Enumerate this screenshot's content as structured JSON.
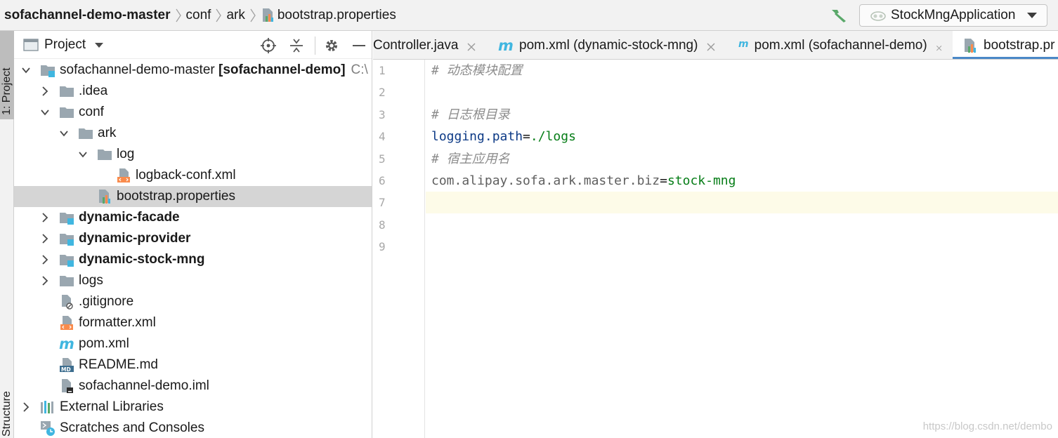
{
  "breadcrumb": {
    "items": [
      "sofachannel-demo-master",
      "conf",
      "ark",
      "bootstrap.properties"
    ]
  },
  "run_config": {
    "label": "StockMngApplication"
  },
  "tool_stripe": {
    "project_label": "1: Project",
    "structure_label": "Structure"
  },
  "project_panel": {
    "title": "Project",
    "tree": [
      {
        "label": "sofachannel-demo-master",
        "suffix": "[sofachannel-demo]",
        "path": "C:\\",
        "icon": "module-folder-icon",
        "depth": 0,
        "arrow": "down"
      },
      {
        "label": ".idea",
        "icon": "folder-icon",
        "depth": 1,
        "arrow": "right"
      },
      {
        "label": "conf",
        "icon": "folder-icon",
        "depth": 1,
        "arrow": "down"
      },
      {
        "label": "ark",
        "icon": "folder-icon",
        "depth": 2,
        "arrow": "down"
      },
      {
        "label": "log",
        "icon": "folder-icon",
        "depth": 3,
        "arrow": "down"
      },
      {
        "label": "logback-conf.xml",
        "icon": "xml-file-icon",
        "depth": 4,
        "arrow": ""
      },
      {
        "label": "bootstrap.properties",
        "icon": "properties-file-icon",
        "depth": 3,
        "arrow": "",
        "selected": true
      },
      {
        "label": "dynamic-facade",
        "icon": "module-folder-icon",
        "depth": 1,
        "arrow": "right",
        "bold": true
      },
      {
        "label": "dynamic-provider",
        "icon": "module-folder-icon",
        "depth": 1,
        "arrow": "right",
        "bold": true
      },
      {
        "label": "dynamic-stock-mng",
        "icon": "module-folder-icon",
        "depth": 1,
        "arrow": "right",
        "bold": true
      },
      {
        "label": "logs",
        "icon": "folder-icon",
        "depth": 1,
        "arrow": "right"
      },
      {
        "label": ".gitignore",
        "icon": "ignored-file-icon",
        "depth": 1,
        "arrow": ""
      },
      {
        "label": "formatter.xml",
        "icon": "xml-file-icon",
        "depth": 1,
        "arrow": ""
      },
      {
        "label": "pom.xml",
        "icon": "maven-icon",
        "depth": 1,
        "arrow": ""
      },
      {
        "label": "README.md",
        "icon": "markdown-file-icon",
        "depth": 1,
        "arrow": ""
      },
      {
        "label": "sofachannel-demo.iml",
        "icon": "iml-file-icon",
        "depth": 1,
        "arrow": ""
      },
      {
        "label": "External Libraries",
        "icon": "libraries-icon",
        "depth": 0,
        "arrow": "right"
      },
      {
        "label": "Scratches and Consoles",
        "icon": "scratches-icon",
        "depth": 0,
        "arrow": ""
      }
    ]
  },
  "editor": {
    "tabs": [
      {
        "label": "Controller.java",
        "icon": "",
        "active": false
      },
      {
        "label": "pom.xml (dynamic-stock-mng)",
        "icon": "maven-icon",
        "active": false
      },
      {
        "label": "pom.xml (sofachannel-demo)",
        "icon": "maven-icon",
        "active": false
      },
      {
        "label": "bootstrap.pr",
        "icon": "properties-file-icon",
        "active": true
      }
    ],
    "line_numbers": [
      "1",
      "2",
      "3",
      "4",
      "5",
      "6",
      "7",
      "8",
      "9"
    ],
    "lines": [
      {
        "comment": "# 动态模块配置"
      },
      {},
      {
        "comment": "# 日志根目录"
      },
      {
        "key": "logging.path",
        "eq": "=",
        "value": "./logs"
      },
      {
        "comment": "# 宿主应用名"
      },
      {
        "key": "com.alipay.sofa.ark.master.biz",
        "eq": "=",
        "value": "stock-mng",
        "key_style": "pkg"
      },
      {
        "caret": true
      },
      {},
      {}
    ],
    "watermark": "https://blog.csdn.net/dembo"
  },
  "colors": {
    "folder": "#9aa7b0",
    "module_badge": "#40b6e0",
    "xml_badge": "#f98b4c",
    "maven": "#40b6e0",
    "hammer": "#59a869",
    "tab_underline": "#4a88c7",
    "selected_row": "#d5d5d5",
    "caret_line": "#fdfbe8"
  }
}
